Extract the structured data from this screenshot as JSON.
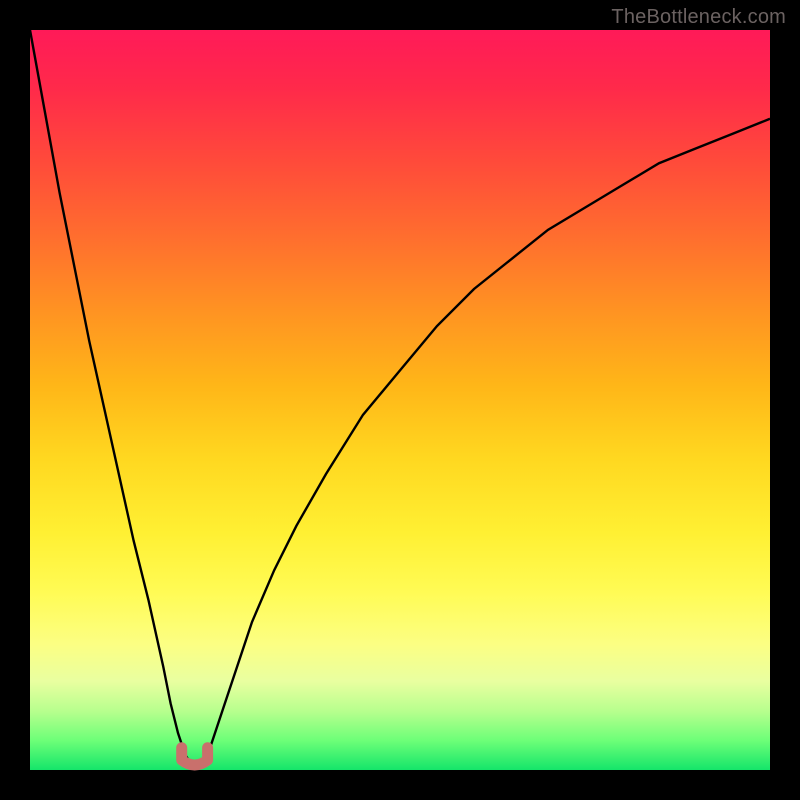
{
  "watermark": {
    "text": "TheBottleneck.com"
  },
  "chart_data": {
    "type": "line",
    "title": "",
    "xlabel": "",
    "ylabel": "",
    "xlim": [
      0,
      100
    ],
    "ylim": [
      0,
      100
    ],
    "note": "Values are read from the plotted curve. x is the horizontal position (0–100 left→right). y is the curve height (0 at bottom, 100 at top of plot). The curve is a V-shape whose minimum sits near x≈22 at the very bottom; left arm rises steeply to ~100 at x=0, right arm rises with decreasing slope to ~88 at x=100.",
    "series": [
      {
        "name": "left-arm",
        "x": [
          0,
          2,
          4,
          6,
          8,
          10,
          12,
          14,
          16,
          18,
          19,
          20,
          21
        ],
        "y": [
          100,
          89,
          78,
          68,
          58,
          49,
          40,
          31,
          23,
          14,
          9,
          5,
          2
        ]
      },
      {
        "name": "trough",
        "x": [
          21,
          22,
          23,
          24
        ],
        "y": [
          2,
          0.5,
          0.5,
          2
        ]
      },
      {
        "name": "right-arm",
        "x": [
          24,
          26,
          28,
          30,
          33,
          36,
          40,
          45,
          50,
          55,
          60,
          65,
          70,
          75,
          80,
          85,
          90,
          95,
          100
        ],
        "y": [
          2,
          8,
          14,
          20,
          27,
          33,
          40,
          48,
          54,
          60,
          65,
          69,
          73,
          76,
          79,
          82,
          84,
          86,
          88
        ]
      }
    ],
    "marker": {
      "description": "Small salmon-colored U-shaped marker at the trough",
      "color": "#c9706c",
      "x_range": [
        20.5,
        24.0
      ],
      "y_range": [
        0,
        3
      ]
    },
    "background_gradient": {
      "top": "#ff1a58",
      "mid": "#ffd820",
      "bottom": "#14e56a"
    }
  }
}
